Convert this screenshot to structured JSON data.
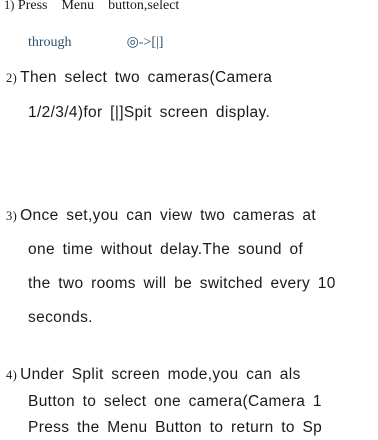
{
  "steps": [
    {
      "number": "1)",
      "lines": [
        [
          "Press",
          "Menu",
          "button,select"
        ],
        [
          "through",
          "◎->[|]"
        ]
      ]
    },
    {
      "number": "2)",
      "lines": [
        "Then select two cameras(Camera",
        "1/2/3/4)for [|]Spit screen display."
      ]
    },
    {
      "number": "3)",
      "lines": [
        "Once set,you can view two cameras at",
        "one time without delay.The sound of",
        "the two rooms will be switched every 10",
        "seconds."
      ]
    },
    {
      "number": "4)",
      "lines": [
        "Under Split screen mode,you can als",
        "Button to select one camera(Camera 1",
        "Press the Menu Button to return to Sp"
      ]
    }
  ]
}
